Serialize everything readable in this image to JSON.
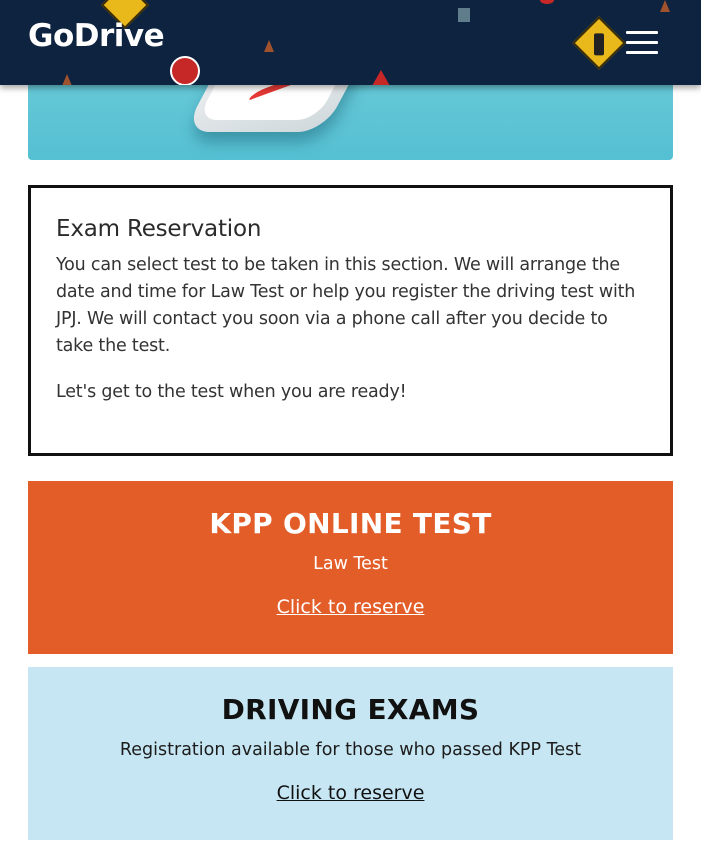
{
  "header": {
    "brand": "GoDrive",
    "menu_icon": "hamburger-menu-icon",
    "background_color": "#0d2340"
  },
  "hero": {
    "image": "phone-with-road-signs-illustration"
  },
  "reservation": {
    "title": "Exam Reservation",
    "paragraph_1": "You can select test to be taken in this section. We will arrange the date and time for Law Test or help you register the driving test with JPJ. We will contact you soon via a phone call after you decide to take the test.",
    "paragraph_2": "Let's get to the test when you are ready!"
  },
  "kpp": {
    "title": "KPP ONLINE TEST",
    "subtitle": "Law Test",
    "link": "Click to reserve",
    "color": "#e35d29"
  },
  "driving": {
    "title": "DRIVING EXAMS",
    "subtitle": "Registration available for those who passed KPP Test",
    "link": "Click to reserve",
    "color": "#c7e6f3"
  }
}
